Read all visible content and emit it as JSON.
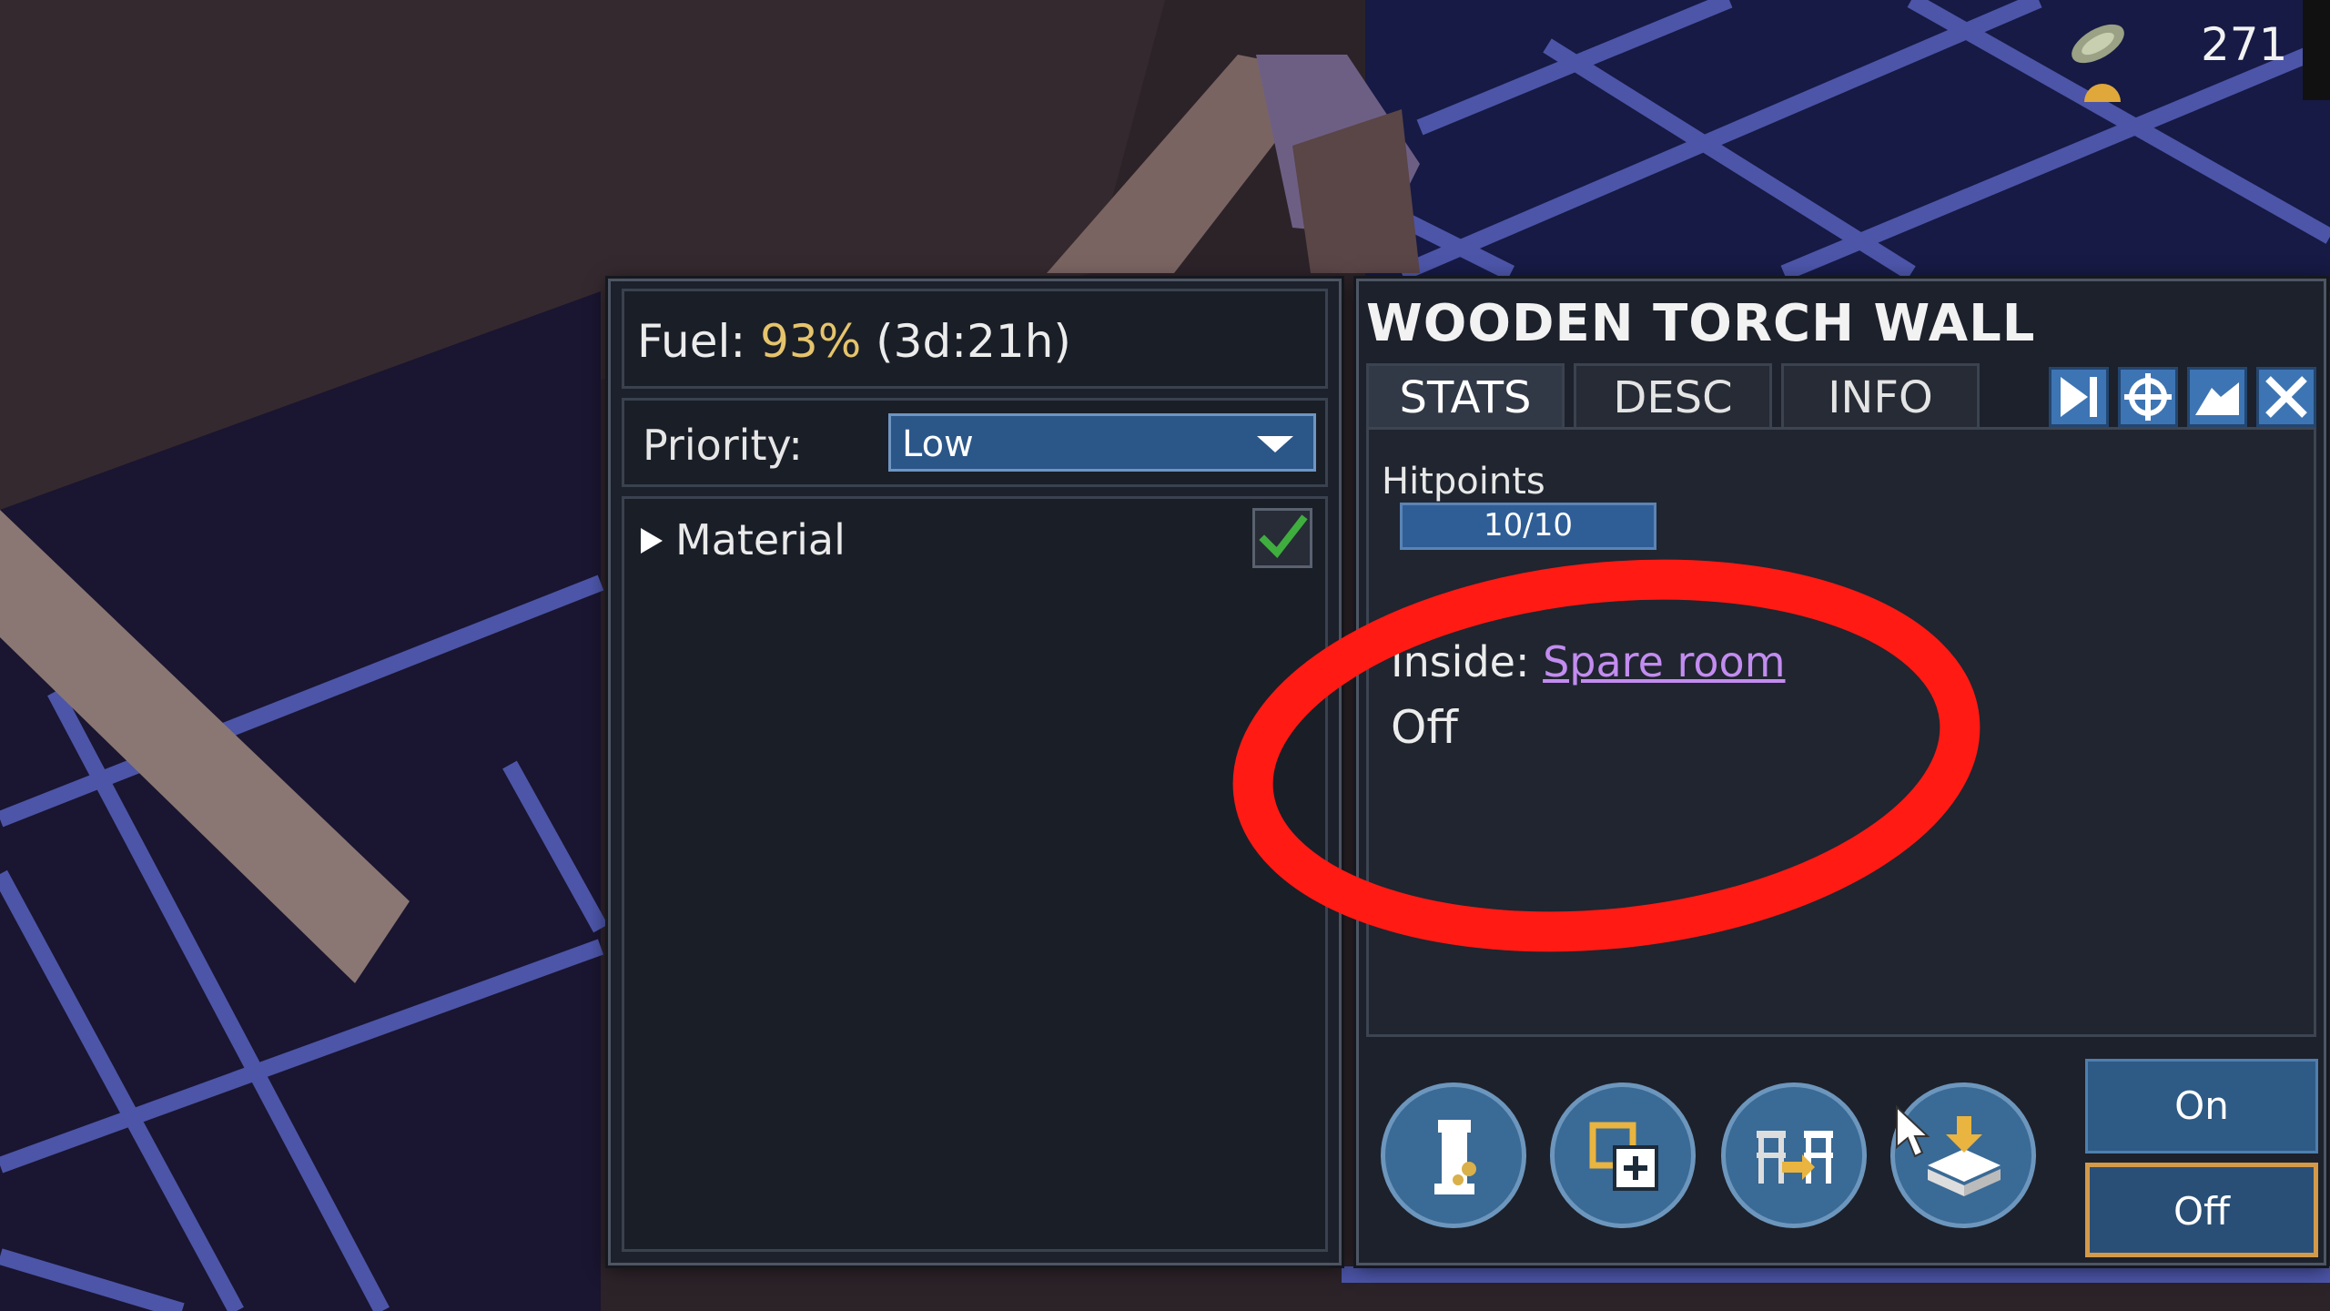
{
  "hud": {
    "resource_icon": "wood-bundle-icon",
    "resource_count": "271"
  },
  "storage_panel": {
    "fuel_label": "Fuel:",
    "fuel_percent": "93%",
    "fuel_time": "(3d:21h)",
    "priority_label": "Priority:",
    "priority_value": "Low",
    "material_label": "Material",
    "material_checked": true
  },
  "info_panel": {
    "title": "WOODEN TORCH WALL",
    "tabs": [
      {
        "label": "STATS",
        "active": true
      },
      {
        "label": "DESC",
        "active": false
      },
      {
        "label": "INFO",
        "active": false
      }
    ],
    "header_icons": [
      "next-icon",
      "locate-icon",
      "expand-icon",
      "close-icon"
    ],
    "hitpoints_label": "Hitpoints",
    "hitpoints_value": "10/10",
    "inside_label": "Inside:",
    "inside_room": "Spare room",
    "state_text": "Off",
    "actions": [
      "deconstruct-icon",
      "copy-icon",
      "move-furniture-icon",
      "install-icon"
    ],
    "on_label": "On",
    "off_label": "Off",
    "selected_toggle": "Off"
  },
  "colors": {
    "accent_blue": "#3d74b3",
    "fuel_yellow": "#e6c46c",
    "link_purple": "#c38cf0",
    "annotation_red": "#ff1a14",
    "toggle_highlight": "#d39a4a"
  }
}
